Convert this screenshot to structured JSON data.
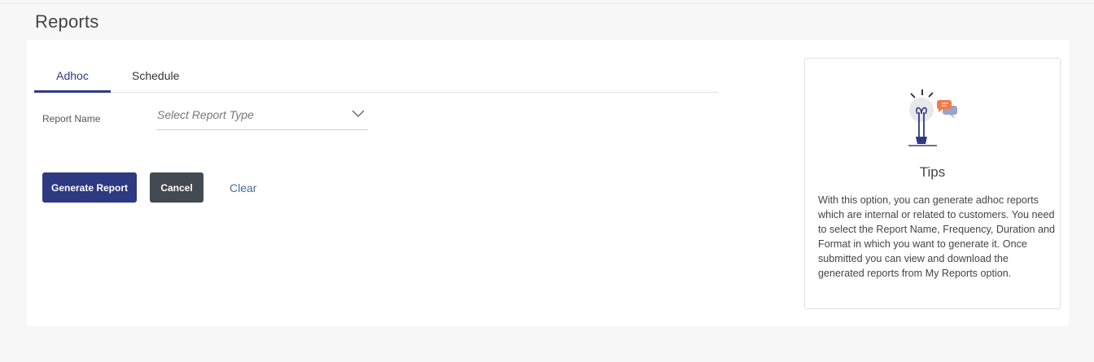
{
  "page": {
    "title": "Reports"
  },
  "tabs": [
    {
      "label": "Adhoc",
      "active": true
    },
    {
      "label": "Schedule",
      "active": false
    }
  ],
  "form": {
    "report_name_label": "Report Name",
    "report_type_placeholder": "Select Report Type"
  },
  "actions": {
    "generate_label": "Generate Report",
    "cancel_label": "Cancel",
    "clear_label": "Clear"
  },
  "tips": {
    "title": "Tips",
    "body": "With this option, you can generate adhoc reports which are internal or related to customers. You need to select the Report Name, Frequency, Duration and Format in which you want to generate it. Once submitted you can view and download the generated reports from My Reports option.",
    "icon": "lightbulb-icon"
  },
  "colors": {
    "primary": "#2d3a82",
    "cancel": "#444a52",
    "link": "#4b6a91",
    "accent_orange": "#f07a4a"
  }
}
